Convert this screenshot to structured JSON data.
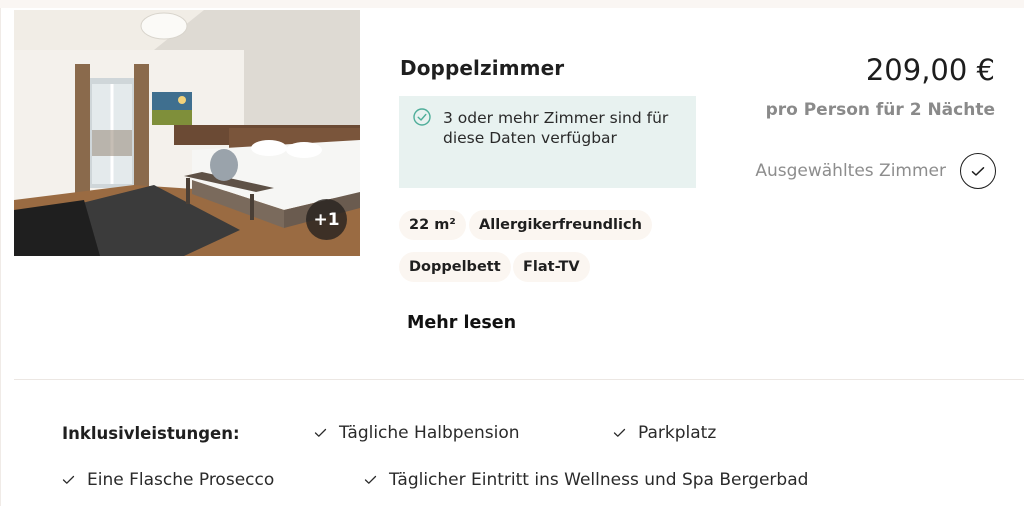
{
  "room": {
    "title": "Doppelzimmer",
    "photo_count_label": "+1",
    "availability": "3 oder mehr Zimmer sind für diese Daten verfügbar",
    "tags": [
      "22 m²",
      "Allergikerfreundlich",
      "Doppelbett",
      "Flat-TV"
    ],
    "read_more": "Mehr lesen"
  },
  "pricing": {
    "price": "209,00 €",
    "per_person": "pro Person für 2 Nächte",
    "selected_label": "Ausgewähltes Zimmer"
  },
  "inclusions": {
    "title": "Inklusivleistungen:",
    "items": [
      "Tägliche Halbpension",
      "Parkplatz",
      "Eine Flasche Prosecco",
      "Täglicher Eintritt ins Wellness und Spa Bergerbad"
    ]
  },
  "icons": {
    "availability": "check-circle-icon",
    "selected": "check-icon",
    "inclusion": "check-icon"
  },
  "colors": {
    "availability_bg": "#e8f2f0",
    "availability_icon": "#4fae9a",
    "tag_bg": "#fbf6f1",
    "muted_text": "#8a8a8a"
  }
}
